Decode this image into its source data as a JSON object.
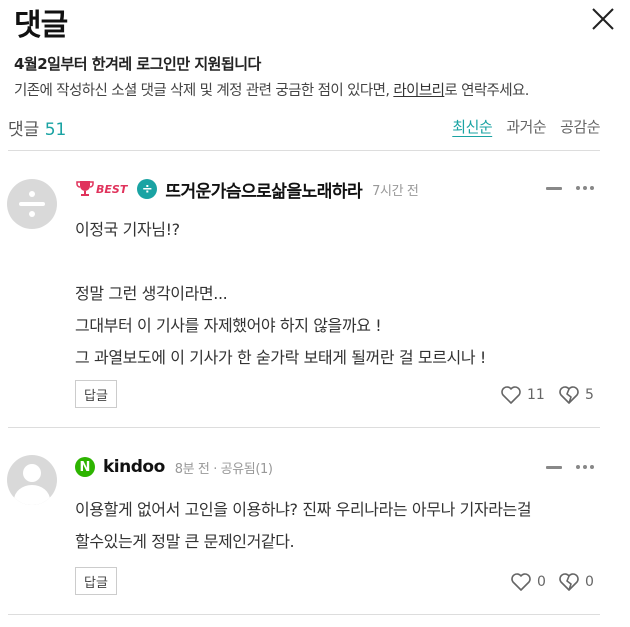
{
  "header": {
    "title": "댓글"
  },
  "notice": {
    "title": "4월2일부터 한겨레 로그인만 지원됩니다",
    "body_prefix": "기존에 작성하신 소셜 댓글 삭제 및 계정 관련 궁금한 점이 있다면, ",
    "link_text": "라이브리",
    "body_suffix": "로 연락주세요."
  },
  "comment_count": {
    "label": "댓글",
    "count": "51"
  },
  "sort_tabs": [
    {
      "label": "최신순",
      "active": true
    },
    {
      "label": "과거순",
      "active": false
    },
    {
      "label": "공감순",
      "active": false
    }
  ],
  "comments": [
    {
      "best_label": "BEST",
      "platform_symbol": "÷",
      "platform_color": "#1aa3a3",
      "username": "뜨거운가슴으로삶을노래하라",
      "timestamp": "7시간 전",
      "lines": [
        "이정국 기자님!?",
        "",
        "정말 그런 생각이라면...",
        "그대부터 이 기사를 자제했어야 하지 않을까요 !",
        "그 과열보도에 이 기사가 한 숟가락 보태게 될꺼란 걸 모르시나 !"
      ],
      "reply_label": "답글",
      "likes": "11",
      "dislikes": "5"
    },
    {
      "platform_symbol": "N",
      "platform_color": "#2db400",
      "username": "kindoo",
      "timestamp": "8분 전 · 공유됨(1)",
      "lines": [
        "이용할게 없어서 고인을 이용하냐? 진짜 우리나라는 아무나 기자라는걸",
        "할수있는게 정말 큰 문제인거같다."
      ],
      "reply_label": "답글",
      "likes": "0",
      "dislikes": "0"
    }
  ],
  "icons": {
    "close": "close-icon",
    "minus": "minus-icon",
    "more": "more-dots-icon",
    "like": "heart-icon",
    "dislike": "broken-heart-icon",
    "best": "trophy-icon"
  }
}
